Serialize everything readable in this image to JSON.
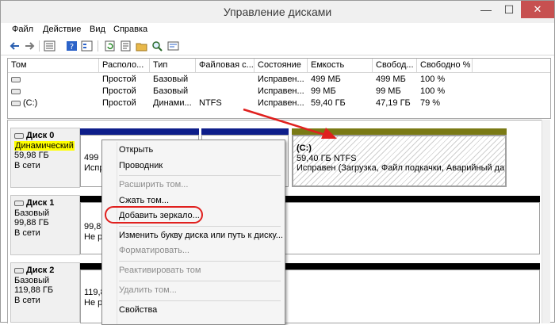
{
  "window": {
    "title": "Управление дисками",
    "close_glyph": "✕",
    "min_glyph": "—",
    "max_glyph": "☐"
  },
  "menu": [
    "Файл",
    "Действие",
    "Вид",
    "Справка"
  ],
  "toolbar_icons": [
    "back-icon",
    "forward-icon",
    "list-view-icon",
    "help-icon",
    "properties-icon",
    "refresh-icon",
    "rescan-icon",
    "open-folder-icon",
    "zoom-icon",
    "settings-icon"
  ],
  "volumes": {
    "headers": [
      "Том",
      "Располо...",
      "Тип",
      "Файловая с...",
      "Состояние",
      "Емкость",
      "Свобод...",
      "Свободно %"
    ],
    "rows": [
      [
        "",
        "Простой",
        "Базовый",
        "",
        "Исправен...",
        "499 МБ",
        "499 МБ",
        "100 %"
      ],
      [
        "",
        "Простой",
        "Базовый",
        "",
        "Исправен...",
        "99 МБ",
        "99 МБ",
        "100 %"
      ],
      [
        "(C:)",
        "Простой",
        "Динами...",
        "NTFS",
        "Исправен...",
        "59,40 ГБ",
        "47,19 ГБ",
        "79 %"
      ]
    ]
  },
  "disks": [
    {
      "name": "Диск 0",
      "type": "Динамический",
      "size": "59,98 ГБ",
      "status": "В сети",
      "part1": {
        "line1": "499 М",
        "line2": "Испра"
      },
      "part_c": {
        "title": "(C:)",
        "fs": "59,40 ГБ NTFS",
        "status": "Исправен (Загрузка, Файл подкачки, Аварийный дамп"
      }
    },
    {
      "name": "Диск 1",
      "type": "Базовый",
      "size": "99,88 ГБ",
      "status": "В сети",
      "part1": {
        "line1": "99,88",
        "line2": "Не ра"
      }
    },
    {
      "name": "Диск 2",
      "type": "Базовый",
      "size": "119,88 ГБ",
      "status": "В сети",
      "part1": {
        "line1": "119,8",
        "line2": "Не ра"
      }
    }
  ],
  "context_menu": {
    "items": [
      {
        "label": "Открыть",
        "enabled": true
      },
      {
        "label": "Проводник",
        "enabled": true
      },
      {
        "label": "Расширить том...",
        "enabled": false
      },
      {
        "label": "Сжать том...",
        "enabled": true
      },
      {
        "label": "Добавить зеркало...",
        "enabled": true
      },
      {
        "label": "Изменить букву диска или путь к диску...",
        "enabled": true
      },
      {
        "label": "Форматировать...",
        "enabled": false
      },
      {
        "label": "Реактивировать том",
        "enabled": false
      },
      {
        "label": "Удалить том...",
        "enabled": false
      },
      {
        "label": "Свойства",
        "enabled": true
      }
    ],
    "highlighted": "Добавить зеркало..."
  },
  "colors": {
    "accent_annotation": "#e0201e",
    "stripe_blue": "#0e1e8a",
    "stripe_olive": "#7a7a15",
    "highlight_yellow": "#ffff00"
  }
}
